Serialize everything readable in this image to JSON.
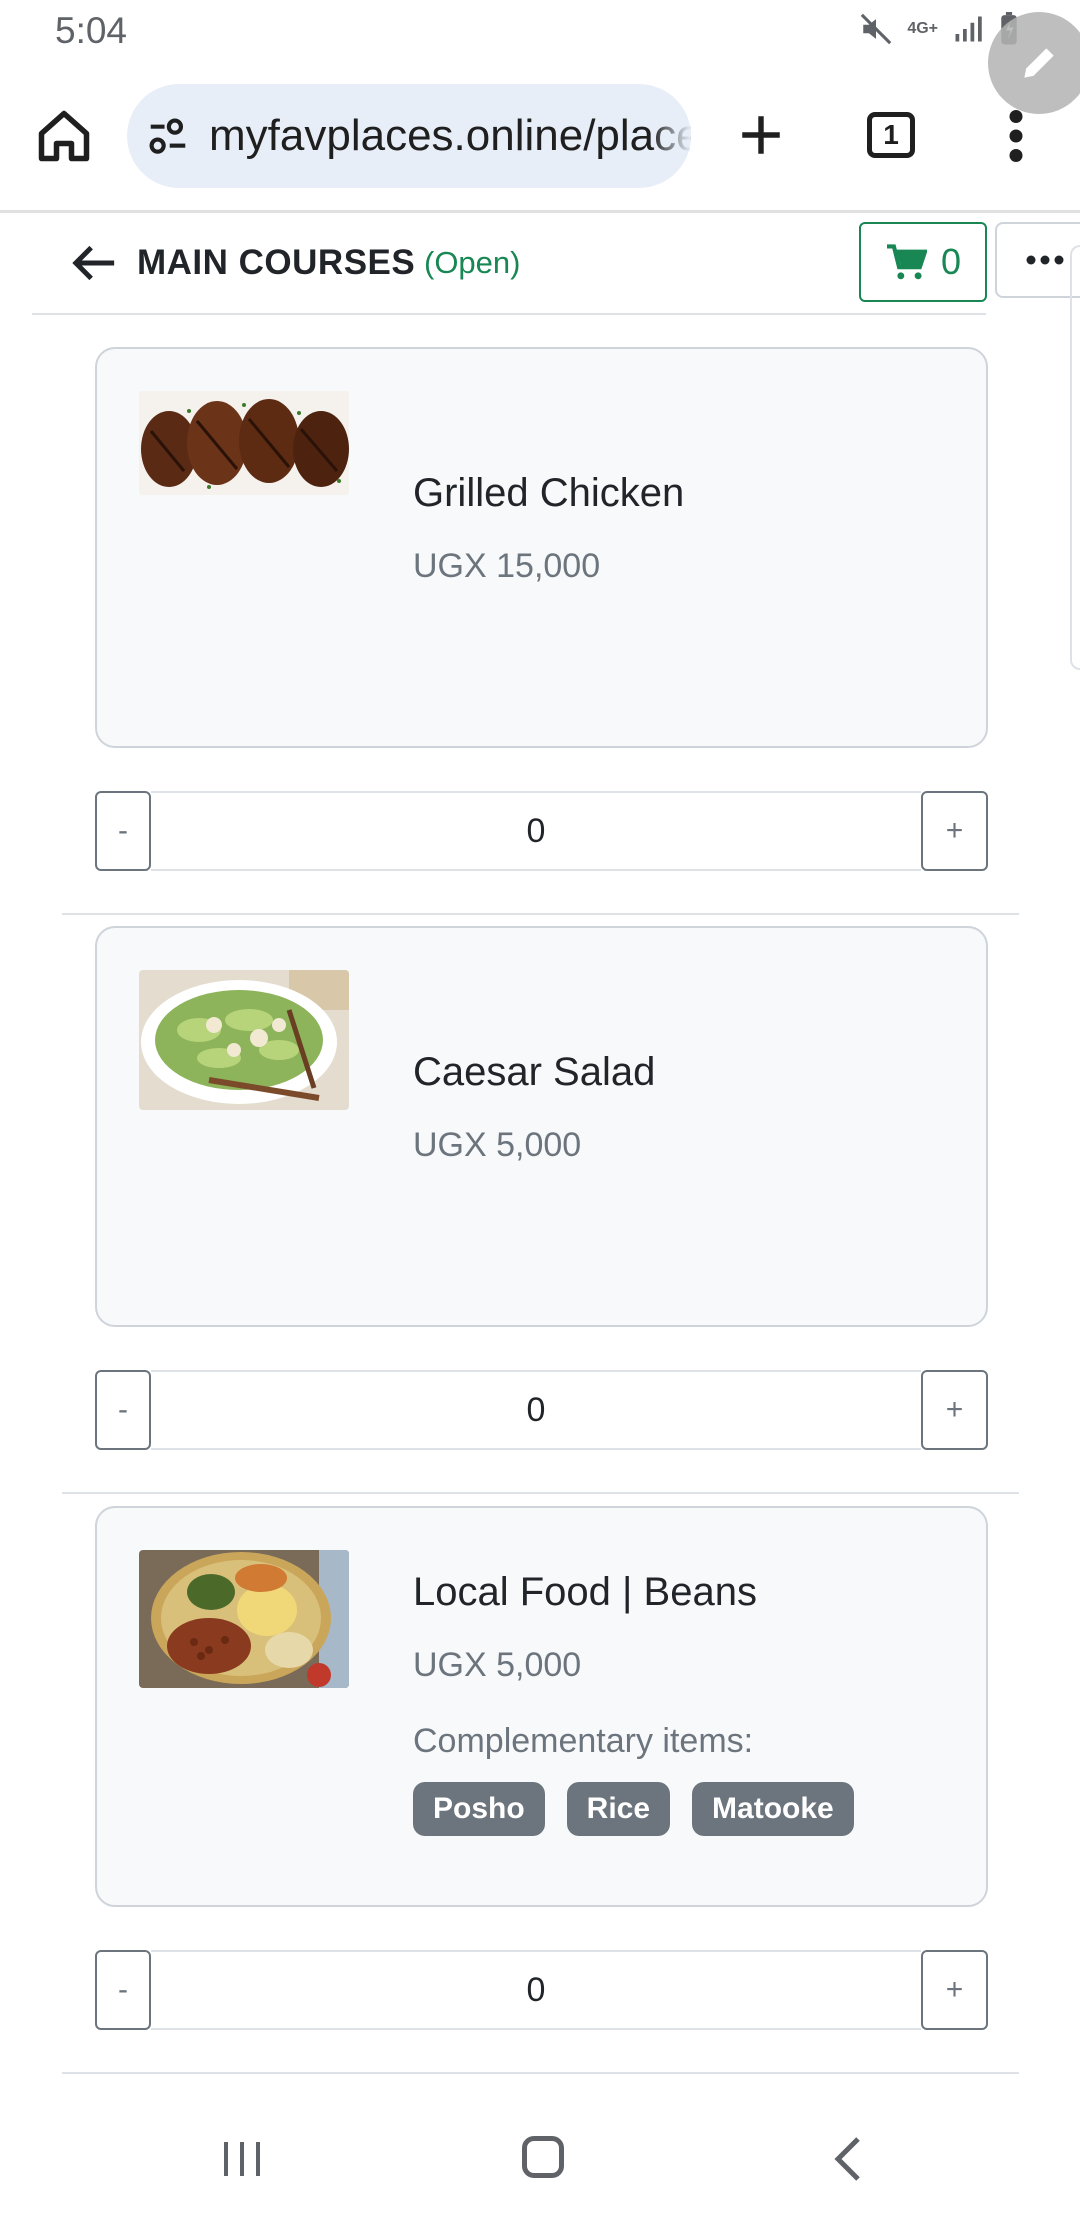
{
  "status_bar": {
    "time": "5:04",
    "network": "4G+"
  },
  "browser": {
    "url": "myfavplaces.online/places",
    "tab_count": "1",
    "icons": [
      "home-icon",
      "site-settings-icon",
      "plus-icon",
      "tab-switcher-icon",
      "more-vert-icon",
      "edit-icon"
    ]
  },
  "header": {
    "title": "MAIN COURSES",
    "status": "(Open)",
    "cart_count": "0",
    "status_color": "#198754"
  },
  "menu_items": [
    {
      "name": "Grilled Chicken",
      "price": "UGX 15,000",
      "quantity": "0",
      "minus": "-",
      "plus": "+"
    },
    {
      "name": "Caesar Salad",
      "price": "UGX 5,000",
      "quantity": "0",
      "minus": "-",
      "plus": "+"
    },
    {
      "name": "Local Food | Beans",
      "price": "UGX 5,000",
      "complementary_label": "Complementary items:",
      "complementary_items": [
        "Posho",
        "Rice",
        "Matooke"
      ],
      "quantity": "0",
      "minus": "-",
      "plus": "+"
    }
  ],
  "colors": {
    "accent_green": "#198754",
    "badge_gray": "#6c757d",
    "card_bg": "#f8f9fa"
  }
}
